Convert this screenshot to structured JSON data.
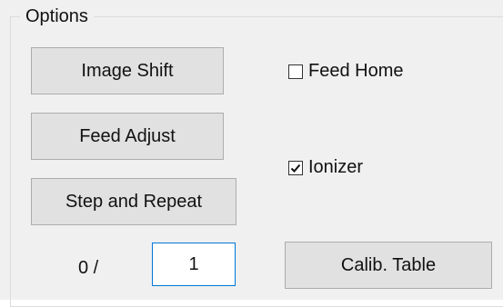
{
  "group": {
    "title": "Options"
  },
  "buttons": {
    "image_shift": "Image Shift",
    "feed_adjust": "Feed Adjust",
    "step_repeat": "Step and Repeat",
    "calib_table": "Calib. Table"
  },
  "checkboxes": {
    "feed_home": {
      "label": "Feed Home",
      "checked": false
    },
    "ionizer": {
      "label": "Ionizer",
      "checked": true
    }
  },
  "counter": {
    "current": "0 /",
    "total": "1"
  }
}
